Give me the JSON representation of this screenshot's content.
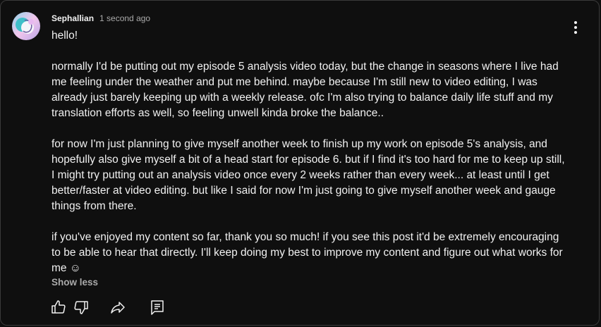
{
  "post": {
    "author": "Sephallian",
    "timestamp": "1 second ago",
    "paragraphs": [
      "hello!",
      "normally I'd be putting out my episode 5 analysis video today, but the change in seasons where I live had me feeling under the weather and put me behind. maybe because I'm still new to video editing, I was already just barely keeping up with a weekly release. ofc I'm also trying to balance daily life stuff and my translation efforts as well, so feeling unwell kinda broke the balance..",
      "for now I'm just planning to give myself another week to finish up my work on episode 5's analysis, and hopefully also give myself a bit of a head start for episode 6. but if I find it's too hard for me to keep up still, I might try putting out an analysis video once every 2 weeks rather than every week... at least until I get better/faster at video editing. but like I said for now I'm just going to give myself another week and gauge things from there.",
      "if you've enjoyed my content so far, thank you so much! if you see this post it'd be extremely encouraging to be able to hear that directly. I'll keep doing my best to improve my content and figure out what works for me ☺"
    ],
    "show_less_label": "Show less"
  },
  "icons": {
    "avatar": "avatar-image",
    "menu": "more-vertical-icon",
    "like": "thumbs-up-icon",
    "dislike": "thumbs-down-icon",
    "share": "share-icon",
    "comment": "comment-icon"
  },
  "colors": {
    "background": "#0f0f0f",
    "border": "#3a3a3a",
    "text": "#f1f1f1",
    "muted": "#aaaaaa"
  }
}
